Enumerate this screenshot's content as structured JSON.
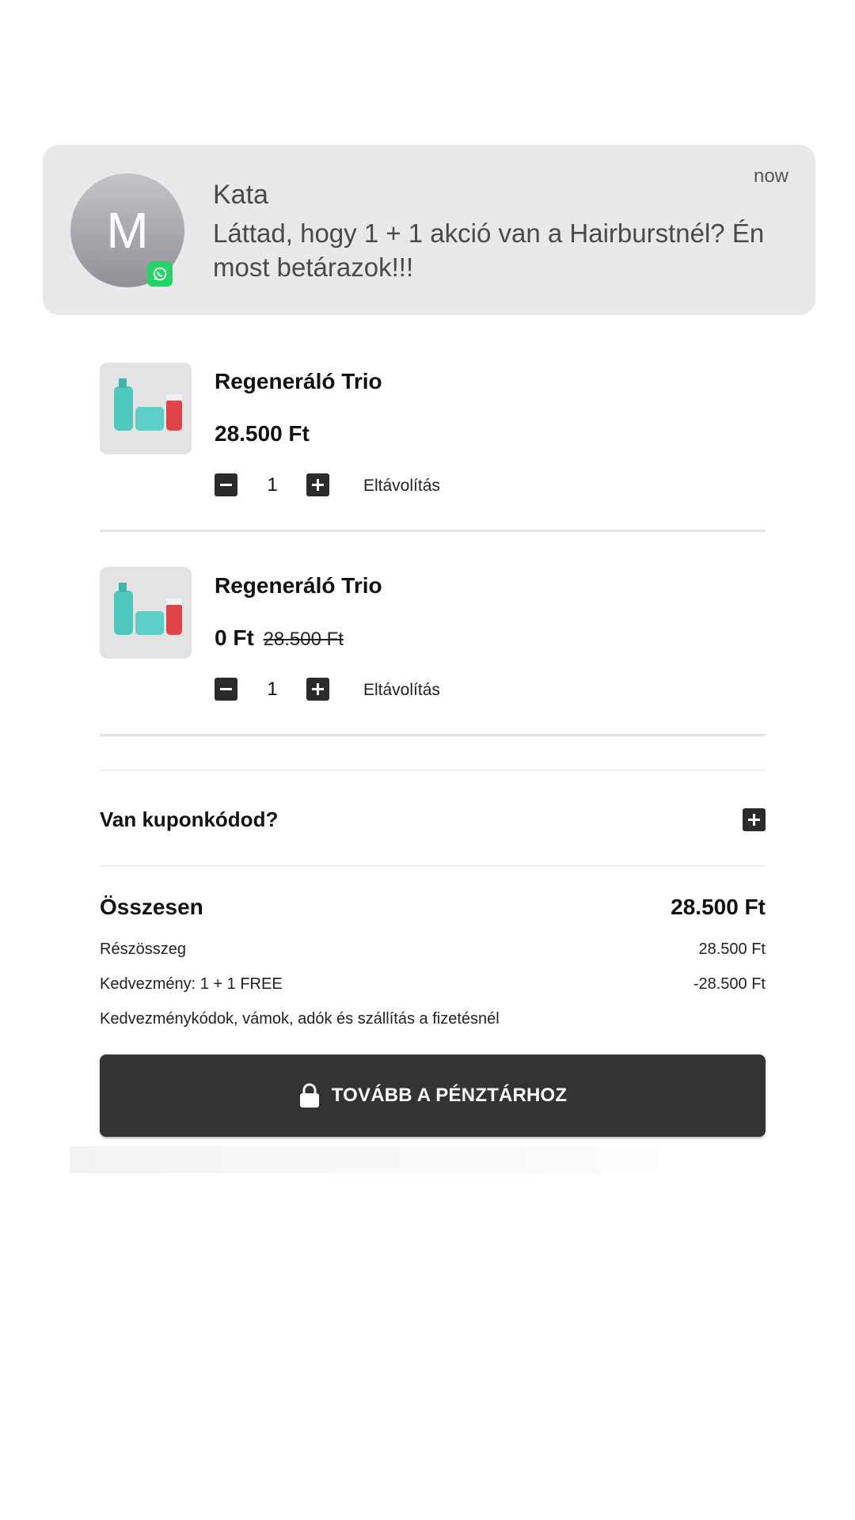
{
  "notification": {
    "avatar_letter": "M",
    "badge_icon": "whatsapp-icon",
    "sender": "Kata",
    "time": "now",
    "message": "Láttad, hogy 1 + 1 akció van a Hairburstnél? Én most betárazok!!!"
  },
  "cart": {
    "items": [
      {
        "title": "Regeneráló Trio",
        "price": "28.500 Ft",
        "old_price": "",
        "quantity": "1",
        "remove_label": "Eltávolítás"
      },
      {
        "title": "Regeneráló Trio",
        "price": "0 Ft",
        "old_price": "28.500 Ft",
        "quantity": "1",
        "remove_label": "Eltávolítás"
      }
    ]
  },
  "coupon": {
    "label": "Van kuponkódod?"
  },
  "summary": {
    "total_label": "Összesen",
    "total_value": "28.500 Ft",
    "subtotal_label": "Részösszeg",
    "subtotal_value": "28.500 Ft",
    "discount_label": "Kedvezmény: 1 + 1 FREE",
    "discount_value": "-28.500 Ft",
    "note": "Kedvezménykódok, vámok, adók és szállítás a fizetésnél"
  },
  "checkout": {
    "label": "TOVÁBB A PÉNZTÁRHOZ",
    "icon": "lock-icon"
  },
  "colors": {
    "notification_bg": "#e9e9e9",
    "button_bg": "#333335",
    "product_teal": "#4fc9c0",
    "product_red": "#e0454a"
  }
}
